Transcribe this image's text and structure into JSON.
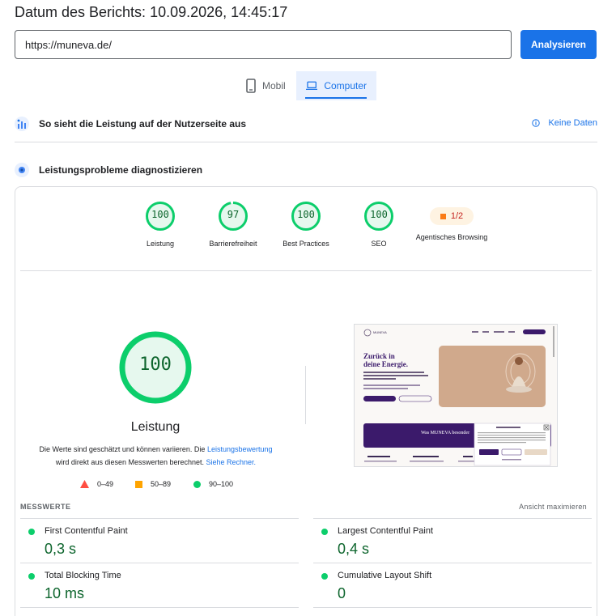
{
  "header": {
    "report_date": "Datum des Berichts: 10.09.2026, 14:45:17"
  },
  "search": {
    "url_value": "https://muneva.de/",
    "analyze_label": "Analysieren"
  },
  "device_tabs": [
    {
      "label": "Mobil",
      "icon": "smartphone-icon",
      "active": false
    },
    {
      "label": "Computer",
      "icon": "laptop-icon",
      "active": true
    }
  ],
  "field_data": {
    "title": "So sieht die Leistung auf der Nutzerseite aus",
    "no_data_label": "Keine Daten"
  },
  "lab_data": {
    "title": "Leistungsprobleme diagnostizieren"
  },
  "categories": [
    {
      "score": "100",
      "label": "Leistung"
    },
    {
      "score": "97",
      "label": "Barrierefreiheit"
    },
    {
      "score": "100",
      "label": "Best Practices"
    },
    {
      "score": "100",
      "label": "SEO"
    },
    {
      "score": "1/2",
      "label": "Agentisches Browsing"
    }
  ],
  "performance": {
    "score": "100",
    "title": "Leistung",
    "desc_part1": "Die Werte sind geschätzt und können variieren. Die ",
    "desc_link1": "Leistungsbewertung",
    "desc_part2": " wird direkt aus diesen Messwerten berechnet. ",
    "desc_link2": "Siehe Rechner.",
    "legend": [
      {
        "range": "0–49",
        "color": "#ff4e42",
        "shape": "triangle"
      },
      {
        "range": "50–89",
        "color": "#ffa400",
        "shape": "square"
      },
      {
        "range": "90–100",
        "color": "#0cce6b",
        "shape": "circle"
      }
    ]
  },
  "screenshot_preview": {
    "nav_brand": "MUNEVA",
    "headline_1": "Zurück in",
    "headline_2": "deine Energie.",
    "banner": "Was MUNEVA besonder"
  },
  "metrics": {
    "header": "MESSWERTE",
    "expand_label": "Ansicht maximieren",
    "items": [
      {
        "name": "First Contentful Paint",
        "value": "0,3 s"
      },
      {
        "name": "Largest Contentful Paint",
        "value": "0,4 s"
      },
      {
        "name": "Total Blocking Time",
        "value": "10 ms"
      },
      {
        "name": "Cumulative Layout Shift",
        "value": "0"
      }
    ]
  },
  "colors": {
    "pass": "#0cce6b",
    "pass_text": "#0d652d",
    "accent": "#1a73e8"
  }
}
